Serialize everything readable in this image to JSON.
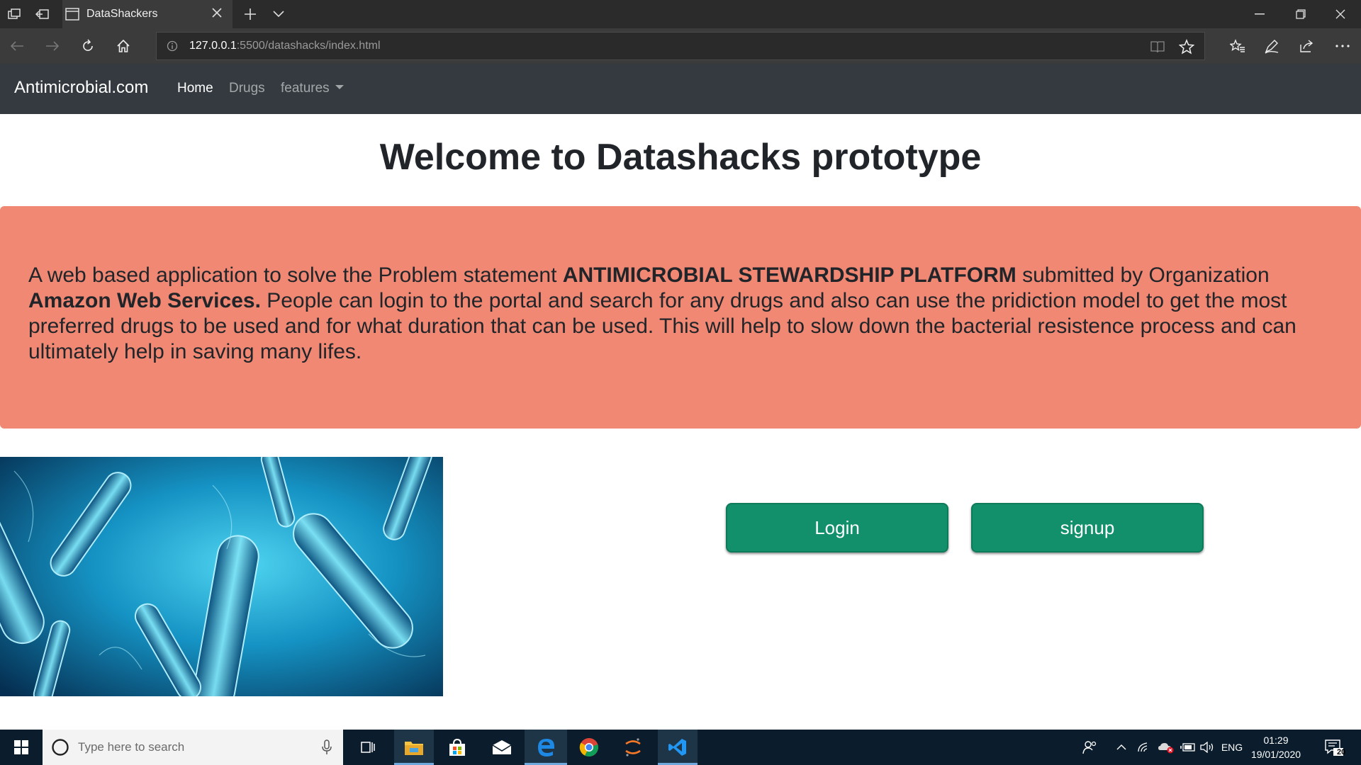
{
  "browser": {
    "tab_title": "DataShackers",
    "url_host": "127.0.0.1",
    "url_path": ":5500/datashacks/index.html"
  },
  "site": {
    "brand": "Antimicrobial.com",
    "nav": [
      {
        "label": "Home"
      },
      {
        "label": "Drugs"
      },
      {
        "label": "features"
      }
    ],
    "title": "Welcome to Datashacks prototype",
    "jumbotron": {
      "text_1": "A web based application to solve the Problem statement ",
      "bold_1": "ANTIMICROBIAL STEWARDSHIP PLATFORM",
      "text_2": " submitted by Organization ",
      "bold_2": "Amazon Web Services.",
      "text_3": " People can login to the portal and search for any drugs and also can use the pridiction model to get the most preferred drugs to be used and for what duration that can be used. This will help to slow down the bacterial resistence process and can ultimately help in saving many lifes."
    },
    "buttons": {
      "login": "Login",
      "signup": "signup"
    },
    "colors": {
      "navbar": "#343a40",
      "jumbotron": "#f08873",
      "button": "#11906b"
    }
  },
  "taskbar": {
    "search_placeholder": "Type here to search",
    "language": "ENG",
    "time": "01:29",
    "date": "19/01/2020",
    "notifications": "20"
  }
}
